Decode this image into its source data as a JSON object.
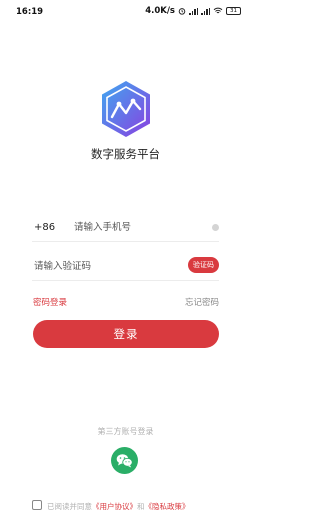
{
  "status_bar": {
    "time": "16:19",
    "speed": "4.0K/s",
    "battery": "31"
  },
  "app": {
    "title": "数字服务平台"
  },
  "login_form": {
    "country_code": "+86",
    "phone_placeholder": "请输入手机号",
    "code_placeholder": "请输入验证码",
    "get_code_label": "验证码",
    "password_login_label": "密码登录",
    "forgot_password_label": "忘记密码",
    "login_button_label": "登录"
  },
  "third_party": {
    "title": "第三方账号登录"
  },
  "agreement": {
    "prefix": "已阅读并同意",
    "user_agreement": "《用户协议》",
    "and": "和",
    "privacy_policy": "《隐私政策》"
  },
  "colors": {
    "accent": "#d93a3f",
    "wechat": "#2aae67"
  }
}
